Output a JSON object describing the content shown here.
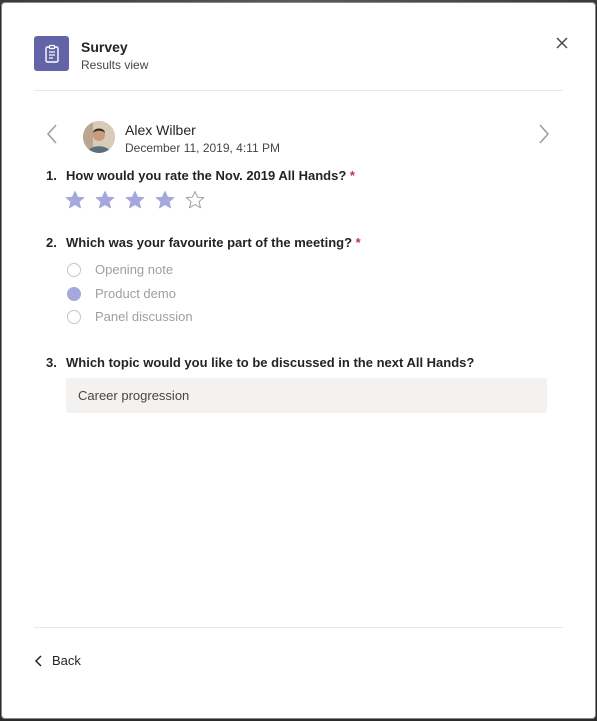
{
  "header": {
    "title": "Survey",
    "subtitle": "Results view"
  },
  "response": {
    "author_name": "Alex Wilber",
    "timestamp": "December 11, 2019, 4:11 PM"
  },
  "questions": [
    {
      "number": "1.",
      "text": "How would you rate the Nov. 2019 All Hands?",
      "required_mark": "*",
      "type": "rating",
      "rating_value": 4,
      "rating_max": 5
    },
    {
      "number": "2.",
      "text": "Which was your favourite part of the meeting?",
      "required_mark": "*",
      "type": "choice",
      "options": [
        "Opening note",
        "Product demo",
        "Panel discussion"
      ],
      "selected": "Product demo"
    },
    {
      "number": "3.",
      "text": "Which topic would you like to be discussed in the next All Hands?",
      "type": "text",
      "answer": "Career progression"
    }
  ],
  "footer": {
    "back_label": "Back"
  },
  "colors": {
    "accent": "#6264a7",
    "selected_fill": "#a6a7dc",
    "required": "#c4314b"
  },
  "icons": {
    "app": "clipboard-icon",
    "close": "close-icon",
    "prev": "chevron-left-icon",
    "next": "chevron-right-icon",
    "back": "chevron-left-icon"
  }
}
